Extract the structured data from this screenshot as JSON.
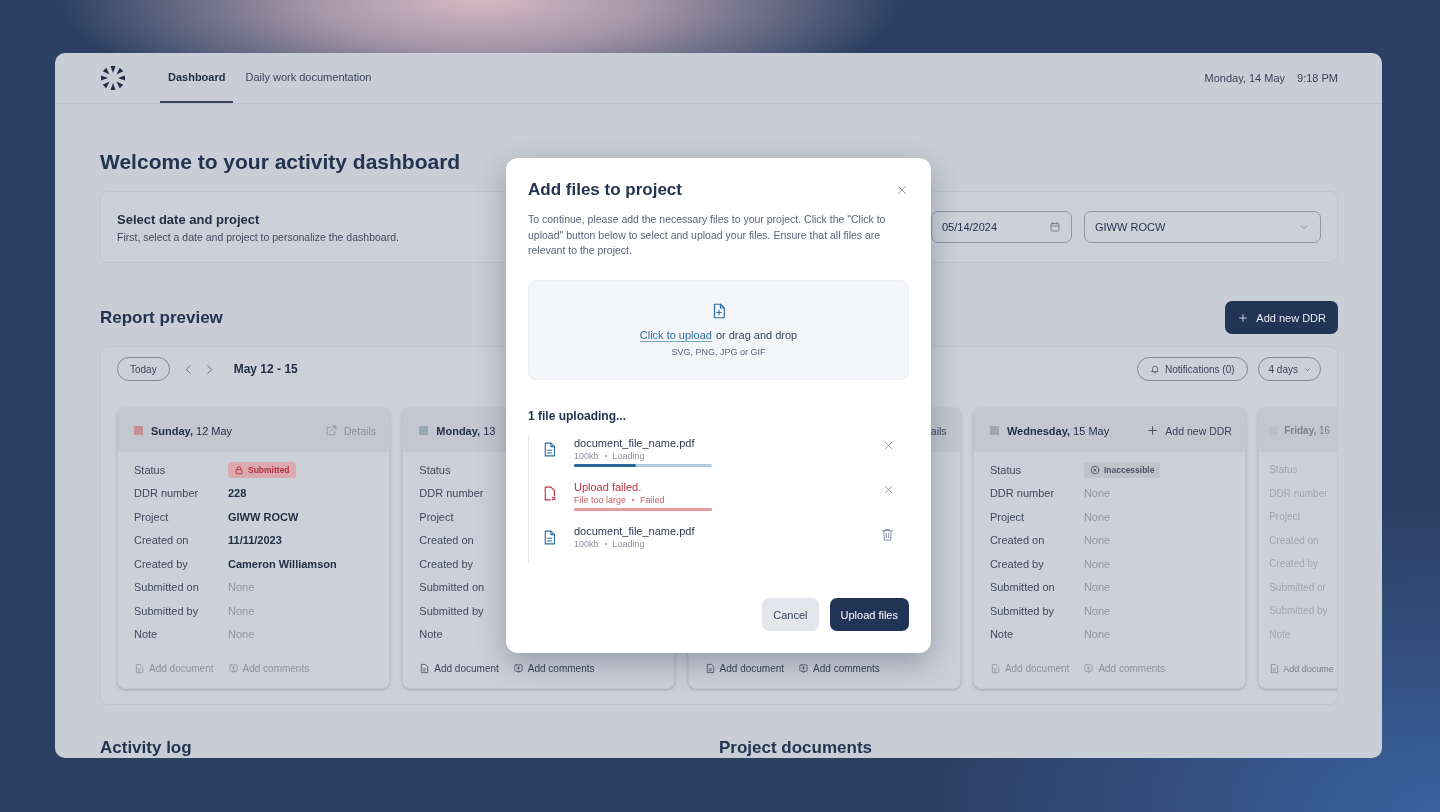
{
  "nav": {
    "tabs": [
      {
        "label": "Dashboard",
        "selected": true
      },
      {
        "label": "Daily work documentation",
        "selected": false
      }
    ],
    "date": "Monday, 14 May",
    "time": "9:18 PM"
  },
  "heading": "Welcome to your activity dashboard",
  "selector": {
    "title": "Select date and project",
    "subtitle": "First, select a date and project to personalize the dashboard.",
    "date": "05/14/2024",
    "project": "GIWW ROCW"
  },
  "report": {
    "title": "Report preview",
    "add_button": "Add new DDR",
    "toolbar": {
      "today": "Today",
      "range": "May 12 - 15",
      "notifications": "Notifications (0)",
      "view": "4 days"
    },
    "cards": [
      {
        "title": "**Sunday,** 12 May",
        "color": "#c98f96",
        "disabled": false,
        "action": {
          "kind": "details",
          "label": "Details",
          "disabled": true
        },
        "rows": [
          {
            "label": "Status",
            "kind": "submitted",
            "value": "Submitted"
          },
          {
            "label": "DDR number",
            "kind": "value",
            "value": "228"
          },
          {
            "label": "Project",
            "kind": "value",
            "value": "GIWW ROCW"
          },
          {
            "label": "Created on",
            "kind": "value",
            "value": "11/11/2023"
          },
          {
            "label": "Created by",
            "kind": "value",
            "value": "Cameron Williamson"
          },
          {
            "label": "Submitted on",
            "kind": "none",
            "value": "None"
          },
          {
            "label": "Submitted by",
            "kind": "none",
            "value": "None"
          },
          {
            "label": "Note",
            "kind": "none",
            "value": "None"
          }
        ],
        "footer": [
          {
            "kind": "document",
            "label": "Add document",
            "disabled": true
          },
          {
            "kind": "comment",
            "label": "Add comments",
            "disabled": true
          }
        ]
      },
      {
        "title": "**Monday,** 13",
        "color": "#98a8b3",
        "disabled": false,
        "rows": [
          {
            "label": "Status",
            "kind": "label"
          },
          {
            "label": "DDR number",
            "kind": "label"
          },
          {
            "label": "Project",
            "kind": "label"
          },
          {
            "label": "Created on",
            "kind": "label"
          },
          {
            "label": "Created by",
            "kind": "label"
          },
          {
            "label": "Submitted on",
            "kind": "label"
          },
          {
            "label": "Submitted by",
            "kind": "label"
          },
          {
            "label": "Note",
            "kind": "label"
          }
        ],
        "footer": [
          {
            "kind": "document",
            "label": "Add document",
            "disabled": false
          },
          {
            "kind": "comment",
            "label": "Add comments",
            "disabled": false
          }
        ]
      },
      {
        "disabled": false,
        "action": {
          "kind": "link",
          "label": "ails",
          "disabled": false
        },
        "footer": [
          {
            "kind": "document",
            "label": "Add document",
            "disabled": false
          },
          {
            "kind": "comment",
            "label": "Add comments",
            "disabled": false
          }
        ]
      },
      {
        "title": "**Wednesday,** 15 May",
        "color": "#a2a6ab",
        "disabled": false,
        "action": {
          "kind": "add",
          "label": "Add new DDR",
          "disabled": false
        },
        "rows": [
          {
            "label": "Status",
            "kind": "inaccessible",
            "value": "Inaccessible"
          },
          {
            "label": "DDR number",
            "kind": "none",
            "value": "None"
          },
          {
            "label": "Project",
            "kind": "none",
            "value": "None"
          },
          {
            "label": "Created on",
            "kind": "none",
            "value": "None"
          },
          {
            "label": "Created by",
            "kind": "none",
            "value": "None"
          },
          {
            "label": "Submitted on",
            "kind": "none",
            "value": "None"
          },
          {
            "label": "Submitted by",
            "kind": "none",
            "value": "None"
          },
          {
            "label": "Note",
            "kind": "none",
            "value": "None"
          }
        ],
        "footer": [
          {
            "kind": "document",
            "label": "Add document",
            "disabled": true
          },
          {
            "kind": "comment",
            "label": "Add comments",
            "disabled": true
          }
        ]
      },
      {
        "title": "**Friday,** 16",
        "color": "#bcc0c6",
        "disabled": true,
        "rows": [
          {
            "label": "Status",
            "kind": "label"
          },
          {
            "label": "DDR number",
            "kind": "label"
          },
          {
            "label": "Project",
            "kind": "label"
          },
          {
            "label": "Created on",
            "kind": "label"
          },
          {
            "label": "Created by",
            "kind": "label"
          },
          {
            "label": "Submitted or",
            "kind": "label"
          },
          {
            "label": "Submitted by",
            "kind": "label"
          },
          {
            "label": "Note",
            "kind": "label"
          }
        ],
        "footer": [
          {
            "kind": "document",
            "label": "Add docume",
            "disabled": false
          }
        ]
      }
    ]
  },
  "sections": [
    "Activity log",
    "Project documents"
  ],
  "modal": {
    "title": "Add files to project",
    "description": "To continue, please add the necessary files to your project. Click the \"Click to upload\" button below to select and upload your files. Ensure that all files are relevant to the project.",
    "dropzone": {
      "link": "Click to upload",
      "text": "or drag and drop",
      "formats": "SVG, PNG, JPG or GIF"
    },
    "progress_title": "1 file uploading...",
    "files": [
      {
        "kind": "loading",
        "name": "document_file_name.pdf",
        "size": "100kb",
        "status": "Loading",
        "level": 0.45,
        "action": {
          "kind": "remove"
        }
      },
      {
        "kind": "failed",
        "name": "Upload failed.",
        "size": "File too large",
        "status": "Failed",
        "level": 1,
        "action": {
          "kind": "remove"
        }
      },
      {
        "kind": "loading",
        "name": "document_file_name.pdf",
        "size": "100kb",
        "status": "Loading",
        "action": {
          "kind": "delete"
        }
      }
    ],
    "buttons": [
      {
        "kind": "secondary",
        "label": "Cancel"
      },
      {
        "kind": "primary",
        "label": "Upload files"
      }
    ]
  }
}
